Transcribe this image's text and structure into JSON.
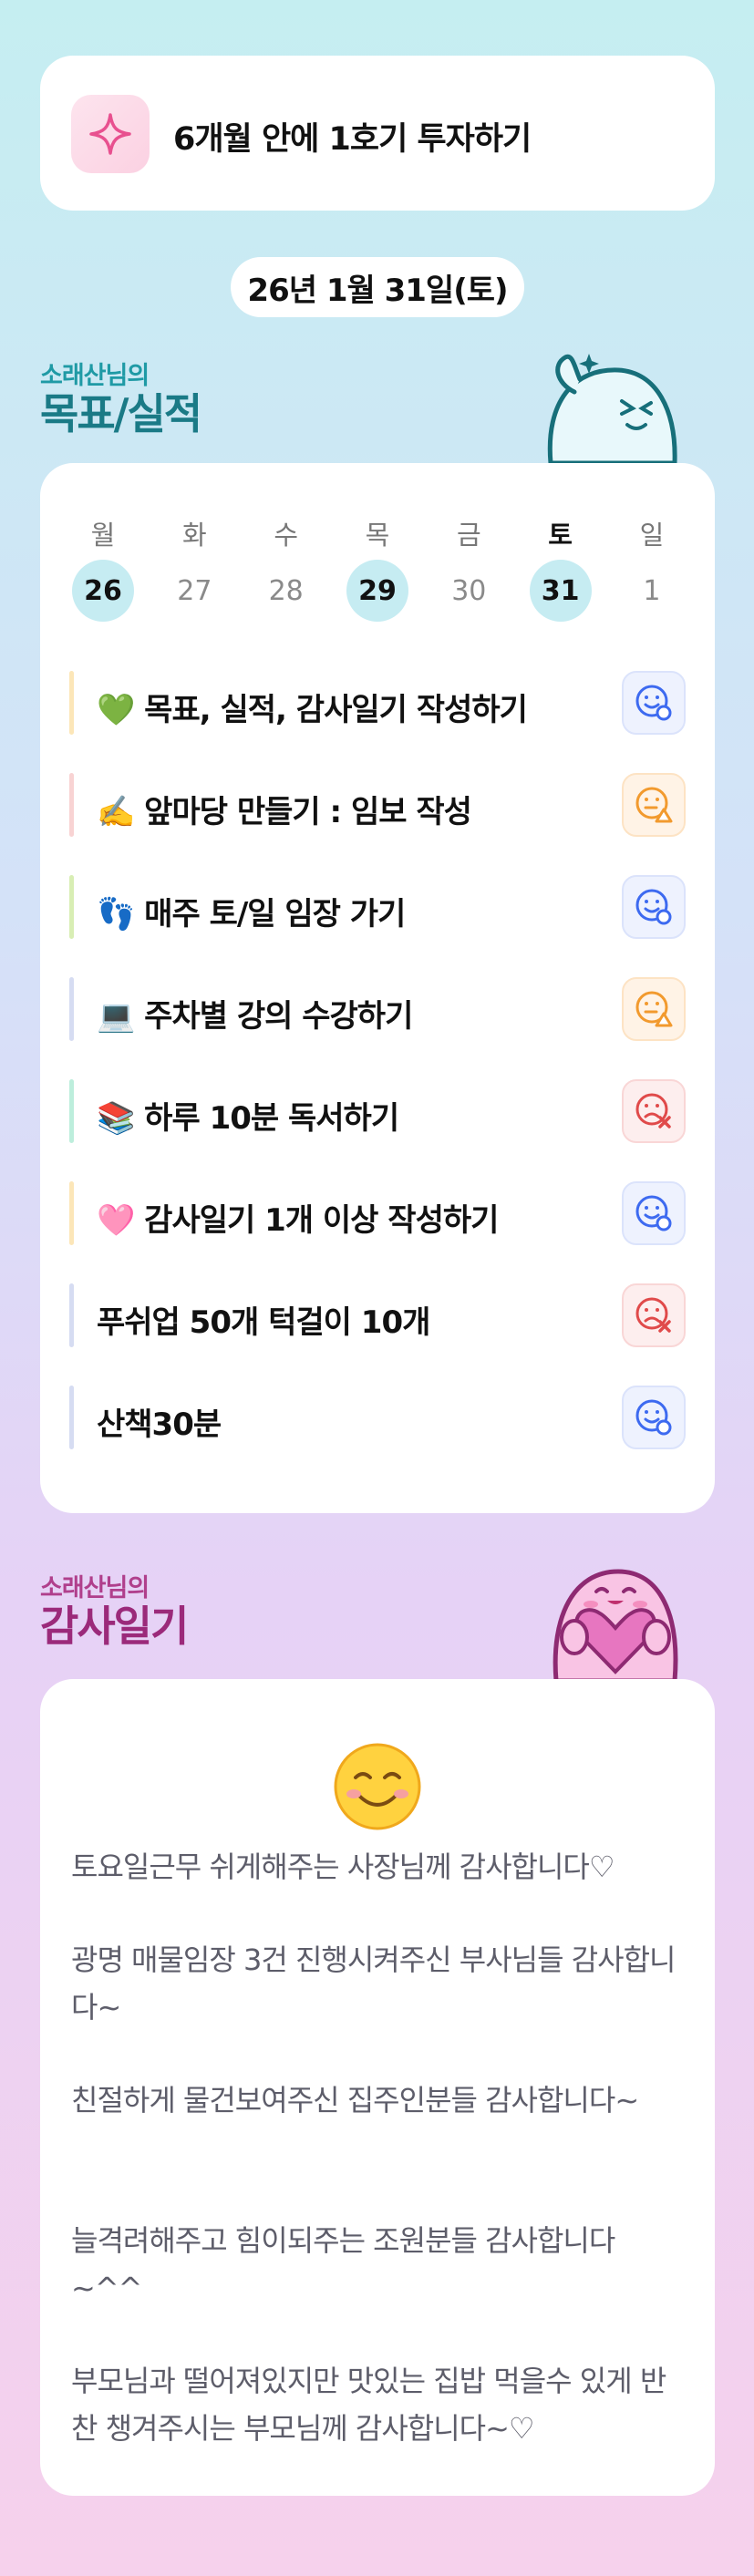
{
  "goal_banner": {
    "text": "6개월 안에 1호기 투자하기",
    "icon": "sparkle-icon"
  },
  "date": "26년 1월 31일(토)",
  "goal_section": {
    "small_label": "소래산님의",
    "big_label": "목표/실적"
  },
  "week": {
    "days": [
      {
        "dow": "월",
        "num": "26",
        "highlight": true,
        "active": false
      },
      {
        "dow": "화",
        "num": "27",
        "highlight": false,
        "active": false
      },
      {
        "dow": "수",
        "num": "28",
        "highlight": false,
        "active": false
      },
      {
        "dow": "목",
        "num": "29",
        "highlight": true,
        "active": false
      },
      {
        "dow": "금",
        "num": "30",
        "highlight": false,
        "active": false
      },
      {
        "dow": "토",
        "num": "31",
        "highlight": true,
        "active": true
      },
      {
        "dow": "일",
        "num": "1",
        "highlight": false,
        "active": false
      }
    ]
  },
  "tasks": [
    {
      "label": "💚 목표, 실적, 감사일기 작성하기",
      "status": "done",
      "bar_color": "#fce6b8"
    },
    {
      "label": "✍️ 앞마당 만들기 : 임보 작성",
      "status": "partial",
      "bar_color": "#f8d3d3"
    },
    {
      "label": "👣 매주 토/일 임장 가기",
      "status": "done",
      "bar_color": "#d8eeb4"
    },
    {
      "label": "💻 주차별 강의 수강하기",
      "status": "partial",
      "bar_color": "#d6dcf2"
    },
    {
      "label": "📚 하루 10분 독서하기",
      "status": "fail",
      "bar_color": "#bdeedc"
    },
    {
      "label": "🩷 감사일기 1개 이상 작성하기",
      "status": "done",
      "bar_color": "#fce6b8"
    },
    {
      "label": "푸쉬업 50개 턱걸이 10개",
      "status": "fail",
      "bar_color": "#d6dcf2"
    },
    {
      "label": "산책30분",
      "status": "done",
      "bar_color": "#d6dcf2"
    }
  ],
  "thanks_section": {
    "small_label": "소래산님의",
    "big_label": "감사일기"
  },
  "thanks": {
    "emoji": "☺️",
    "paragraphs": [
      "토요일근무 쉬게해주는 사장님께 감사합니다♡",
      "광명 매물임장 3건 진행시켜주신 부사님들 감사합니다~",
      "친절하게 물건보여주신 집주인분들 감사합니다~",
      "늘격려해주고 힘이되주는 조원분들 감사합니다~^^",
      "부모님과 떨어져있지만 맛있는 집밥 먹을수 있게 반찬 챙겨주시는 부모님께 감사합니다~♡"
    ]
  },
  "colors": {
    "highlight": "#c6ecf2",
    "done_status": "#3d6af0",
    "partial_status": "#f29a2e",
    "fail_status": "#e04a4a",
    "goal_label": "#1a7a86",
    "thanks_label": "#9b2a7a"
  }
}
